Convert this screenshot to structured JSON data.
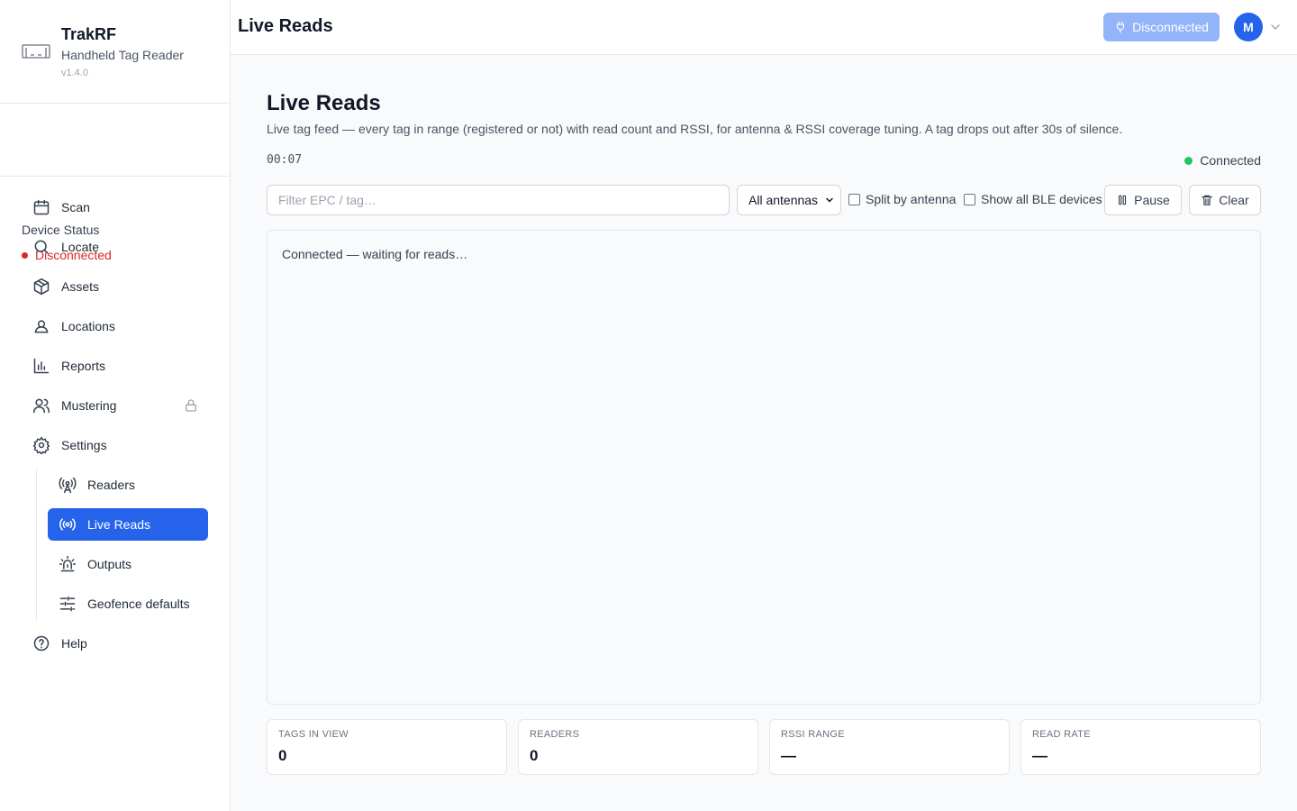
{
  "brand": {
    "name": "TrakRF",
    "subtitle": "Handheld Tag Reader",
    "version": "v1.4.0"
  },
  "device_status": {
    "label": "Device Status",
    "value": "Disconnected",
    "color": "#dc2626"
  },
  "nav": {
    "items": [
      {
        "label": "Scan",
        "icon": "calendar-icon"
      },
      {
        "label": "Locate",
        "icon": "search-icon"
      },
      {
        "label": "Assets",
        "icon": "box-icon"
      },
      {
        "label": "Locations",
        "icon": "map-pin-icon"
      },
      {
        "label": "Reports",
        "icon": "bar-chart-icon"
      },
      {
        "label": "Mustering",
        "icon": "users-icon",
        "locked": true
      },
      {
        "label": "Settings",
        "icon": "gear-icon"
      }
    ],
    "settings_sub": [
      {
        "label": "Readers",
        "icon": "antenna-icon"
      },
      {
        "label": "Live Reads",
        "icon": "broadcast-icon",
        "active": true
      },
      {
        "label": "Outputs",
        "icon": "siren-icon"
      },
      {
        "label": "Geofence defaults",
        "icon": "sliders-icon"
      }
    ],
    "help": {
      "label": "Help",
      "icon": "help-icon"
    }
  },
  "topbar": {
    "title": "Live Reads",
    "connection_button": "Disconnected",
    "avatar_initial": "M"
  },
  "main": {
    "title": "Live Reads",
    "description": "Live tag feed — every tag in range (registered or not) with read count and RSSI, for antenna & RSSI coverage tuning. A tag drops out after 30s of silence.",
    "timer": "00:07",
    "connection_status": "Connected",
    "filter_placeholder": "Filter EPC / tag…",
    "antenna_select": "All antennas",
    "split_by_antenna": "Split by antenna",
    "show_ble": "Show all BLE devices",
    "pause_label": "Pause",
    "clear_label": "Clear",
    "feed_message": "Connected — waiting for reads…",
    "stats": [
      {
        "label": "TAGS IN VIEW",
        "value": "0"
      },
      {
        "label": "READERS",
        "value": "0"
      },
      {
        "label": "RSSI RANGE",
        "value": "—"
      },
      {
        "label": "READ RATE",
        "value": "—"
      }
    ]
  },
  "colors": {
    "accent": "#2563eb",
    "connected": "#22c55e",
    "disconnected": "#dc2626"
  }
}
